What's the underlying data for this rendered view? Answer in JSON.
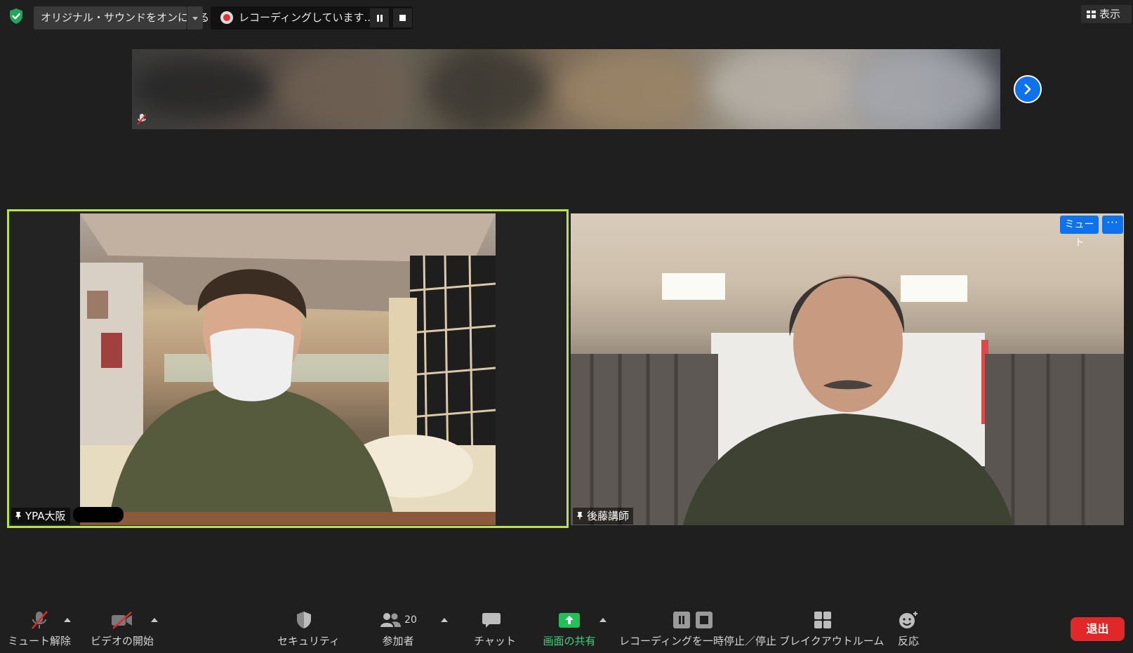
{
  "top_bar": {
    "original_sound_label": "オリジナル・サウンドをオンにする",
    "recording_status": "レコーディングしています...",
    "view_label": "表示"
  },
  "participants": [
    {
      "name": "YPA大阪",
      "pinned": true,
      "active_speaker": true
    },
    {
      "name": "後藤講師",
      "pinned": true,
      "active_speaker": false
    }
  ],
  "tile_controls": {
    "mute_label": "ミュート",
    "more_label": "···"
  },
  "toolbar": {
    "unmute": "ミュート解除",
    "start_video": "ビデオの開始",
    "security": "セキュリティ",
    "participants": "参加者",
    "participant_count": "20",
    "chat": "チャット",
    "share_screen": "画面の共有",
    "recording_controls": "レコーディングを一時停止／停止",
    "breakout_rooms": "ブレイクアウトルーム",
    "reactions": "反応",
    "leave": "退出"
  },
  "colors": {
    "accent_blue": "#0e72ed",
    "active_speaker_border": "#b6e24d",
    "share_green": "#3ed37a",
    "leave_red": "#e02828",
    "background": "#1f1f1f"
  },
  "icons": [
    "shield-check-icon",
    "record-icon",
    "pause-icon",
    "stop-icon",
    "grid-view-icon",
    "chevron-right-icon",
    "muted-mic-icon",
    "video-off-icon",
    "security-shield-icon",
    "participants-icon",
    "chat-icon",
    "share-screen-icon",
    "breakout-rooms-icon",
    "reaction-icon",
    "pin-icon"
  ]
}
